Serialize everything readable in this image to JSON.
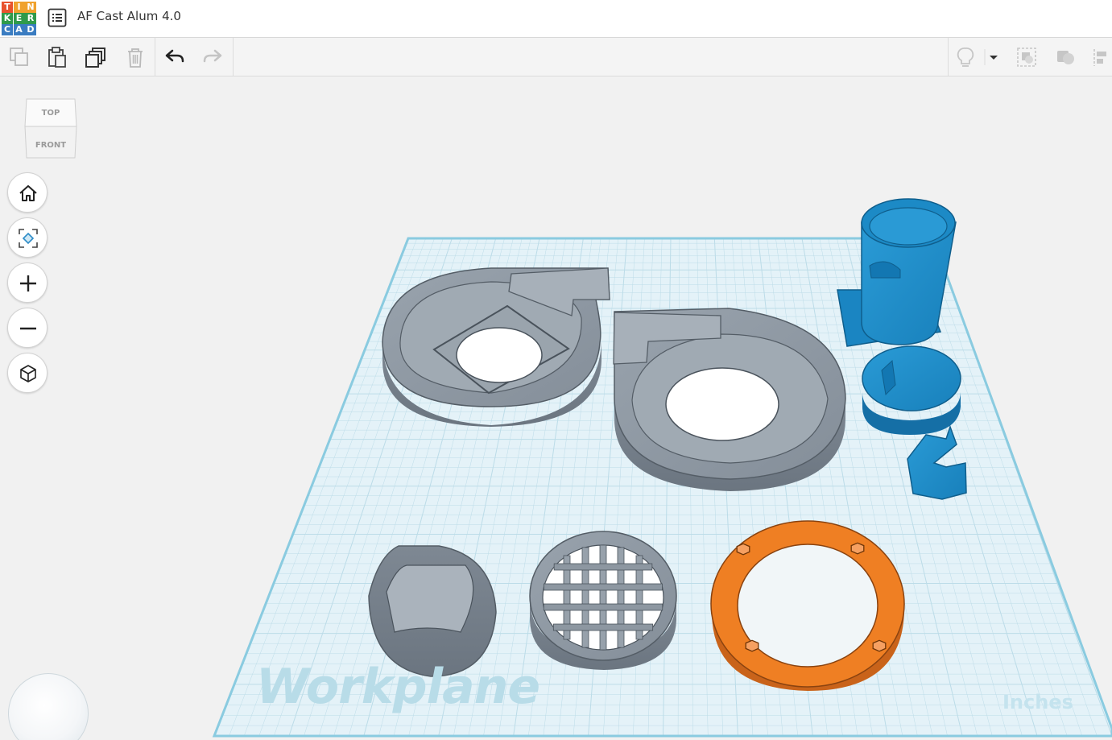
{
  "app": {
    "logo_letters": [
      "T",
      "I",
      "N",
      "K",
      "E",
      "R",
      "C",
      "A",
      "D"
    ],
    "logo_colors": [
      "#e8532f",
      "#f0a22e",
      "#f0a22e",
      "#2f9a4a",
      "#2f9a4a",
      "#2f9a4a",
      "#3a7cc1",
      "#3a7cc1",
      "#3a7cc1"
    ],
    "document_title": "AF Cast Alum 4.0"
  },
  "toolbar": {
    "copy": "copy-icon",
    "paste": "paste-icon",
    "duplicate": "duplicate-icon",
    "delete": "trash-icon",
    "undo": "undo-icon",
    "redo": "redo-icon",
    "light": "lightbulb-icon",
    "group": "group-icon",
    "ungroup": "ungroup-icon",
    "align": "align-icon"
  },
  "viewcube": {
    "top_label": "TOP",
    "front_label": "FRONT"
  },
  "nav": {
    "home": "home-icon",
    "fit": "fit-view-icon",
    "zoom_in": "plus-icon",
    "zoom_out": "minus-icon",
    "projection": "perspective-cube-icon"
  },
  "workplane": {
    "label": "Workplane",
    "units": "Inches",
    "colors": {
      "plane": "#e4f2f8",
      "grid": "#bcdce8",
      "edge": "#7fc4dc"
    }
  },
  "shapes": {
    "colors": {
      "gray": "#8c96a1",
      "blue": "#1d8dca",
      "orange": "#ef7f23"
    }
  }
}
